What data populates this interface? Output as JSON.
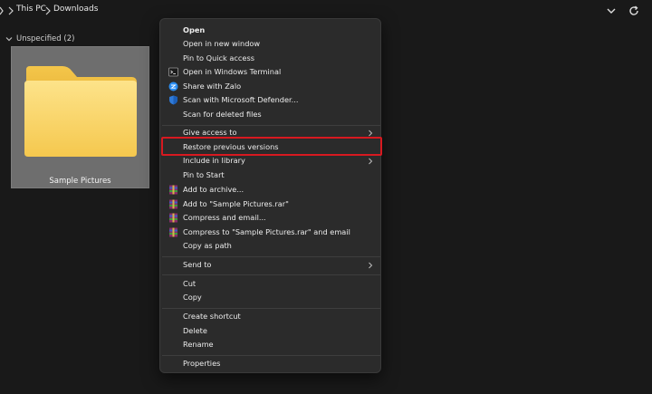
{
  "address_bar": {
    "crumbs": [
      "This PC",
      "Downloads"
    ]
  },
  "group": {
    "header": "Unspecified (2)"
  },
  "folder": {
    "name": "Sample Pictures"
  },
  "context_menu": {
    "open": "Open",
    "open_new_window": "Open in new window",
    "pin_quick_access": "Pin to Quick access",
    "open_terminal": "Open in Windows Terminal",
    "share_zalo": "Share with Zalo",
    "scan_defender": "Scan with Microsoft Defender...",
    "scan_deleted": "Scan for deleted files",
    "give_access": "Give access to",
    "restore_versions": "Restore previous versions",
    "include_library": "Include in library",
    "pin_start": "Pin to Start",
    "add_archive": "Add to archive...",
    "add_rar": "Add to \"Sample Pictures.rar\"",
    "compress_email": "Compress and email...",
    "compress_rar_email": "Compress to \"Sample Pictures.rar\" and email",
    "copy_path": "Copy as path",
    "send_to": "Send to",
    "cut": "Cut",
    "copy": "Copy",
    "create_shortcut": "Create shortcut",
    "delete": "Delete",
    "rename": "Rename",
    "properties": "Properties"
  },
  "colors": {
    "highlight": "#d71920",
    "menu_bg": "#2b2b2b",
    "folder_yellow": "#f7cf5a"
  }
}
